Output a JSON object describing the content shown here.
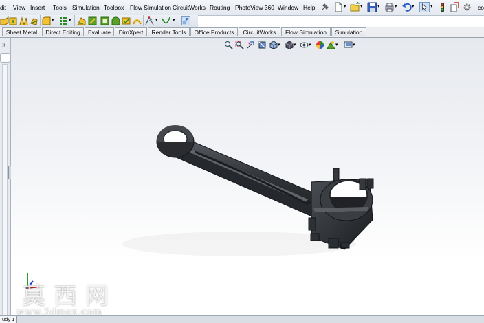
{
  "menubar": {
    "items": [
      "dit",
      "View",
      "Insert",
      "Tools",
      "Simulation",
      "Toolbox",
      "Flow Simulation",
      "CircuitWorks",
      "Routing",
      "PhotoView 360",
      "Window",
      "Help"
    ],
    "trailing_text": "co"
  },
  "command_tabs": [
    "Sheet Metal",
    "Direct Editing",
    "Evaluate",
    "DimXpert",
    "Render Tools",
    "Office Products",
    "CircuitWorks",
    "Flow Simulation",
    "Simulation"
  ],
  "left_panel": {
    "collapse_glyph": "»"
  },
  "status_bar": {
    "tab_label": "udy 1"
  },
  "watermark": {
    "chars": [
      "莫",
      "西",
      "网"
    ],
    "url": "www.3dmox.com"
  },
  "icons": [
    "pin-icon",
    "new-document-icon",
    "open-icon",
    "save-icon",
    "print-icon",
    "undo-icon",
    "select-cursor-icon",
    "rebuild-icon",
    "file-properties-icon",
    "options-icon",
    "zoom-to-fit-icon",
    "zoom-to-area-icon",
    "previous-view-icon",
    "section-view-icon",
    "view-orientation-icon",
    "display-style-icon",
    "hide-show-icon",
    "edit-appearance-icon",
    "apply-scene-icon",
    "view-settings-icon",
    "triad-icon"
  ],
  "colors": {
    "part": "#3a3d42",
    "menubar": "#e8ecf2",
    "viewport_top": "#e6e9ee",
    "viewport_bottom": "#ffffff",
    "triad_x": "#d62020",
    "triad_y": "#2a9d2a",
    "triad_z": "#2040d0"
  }
}
